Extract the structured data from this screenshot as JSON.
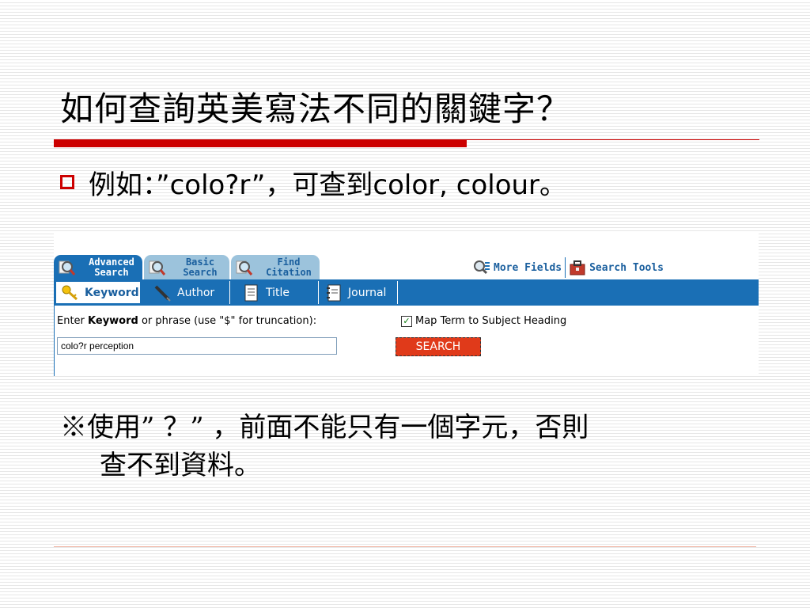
{
  "slide": {
    "title": "如何查詢英美寫法不同的關鍵字？",
    "bullet": "例如：”colo?r”，可查到color, colour。",
    "note_line1": "※使用” ？” ，前面不能只有一個字元，否則",
    "note_line2": "查不到資料。"
  },
  "screenshot": {
    "tabs": [
      {
        "label": "Advanced Search",
        "icon": "magnifier-icon"
      },
      {
        "label": "Basic Search",
        "icon": "magnifier-icon"
      },
      {
        "label": "Find Citation",
        "icon": "magnifier-icon"
      }
    ],
    "top_links": {
      "more_fields": "More Fields",
      "search_tools": "Search Tools"
    },
    "subtabs": [
      {
        "label": "Keyword",
        "icon": "key-icon"
      },
      {
        "label": "Author",
        "icon": "pen-icon"
      },
      {
        "label": "Title",
        "icon": "document-icon"
      },
      {
        "label": "Journal",
        "icon": "notebook-icon"
      }
    ],
    "prompt_prefix": "Enter ",
    "prompt_bold": "Keyword",
    "prompt_suffix": " or phrase (use \"$\" for truncation):",
    "map_term_label": "Map Term to Subject Heading",
    "map_term_checked": true,
    "search_value": "colo?r perception",
    "search_button": "SEARCH"
  },
  "colors": {
    "accent_red": "#cc0000",
    "ovid_blue": "#1a6fb5",
    "search_button": "#e03a1a"
  }
}
